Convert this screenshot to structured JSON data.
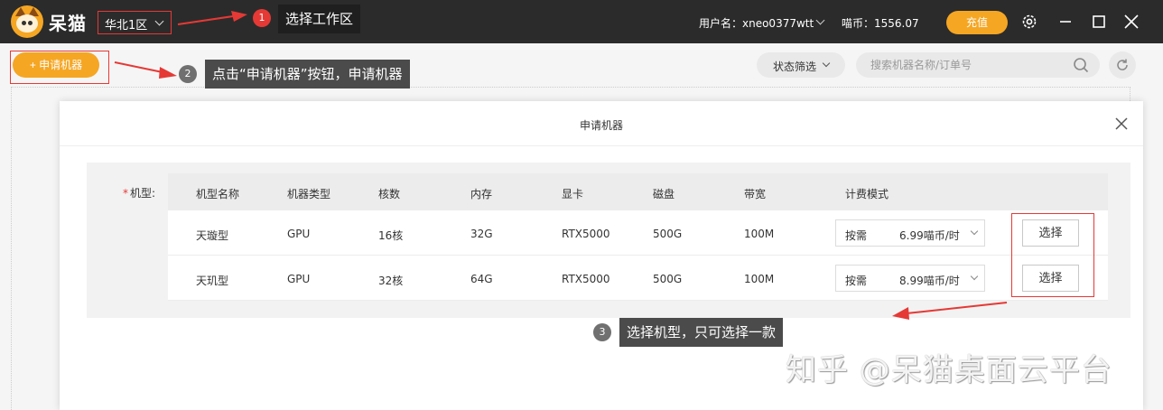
{
  "app": {
    "name": "呆猫"
  },
  "topbar": {
    "region": "华北1区",
    "user": "用户名：xneo0377wtt",
    "balance": "喵币：1556.07",
    "recharge_label": "充值"
  },
  "toolbar": {
    "apply_label": "+ 申请机器",
    "status_filter": "状态筛选",
    "search_placeholder": "搜索机器名称/订单号"
  },
  "annotations": [
    {
      "badge": "1",
      "text": "选择工作区"
    },
    {
      "badge": "2",
      "text": "点击“申请机器”按钮，申请机器"
    },
    {
      "badge": "3",
      "text": "选择机型，只可选择一款"
    }
  ],
  "dialog": {
    "title": "申请机器",
    "field_label": "机型:",
    "required_mark": "*",
    "columns": [
      "机型名称",
      "机器类型",
      "核数",
      "内存",
      "显卡",
      "磁盘",
      "带宽",
      "计费模式"
    ],
    "rows": [
      {
        "name": "天璇型",
        "type": "GPU",
        "cores": "16核",
        "memory": "32G",
        "gpu": "RTX5000",
        "disk": "500G",
        "bandwidth": "100M",
        "billing_mode": "按需",
        "price": "6.99喵币/时",
        "action": "选择"
      },
      {
        "name": "天玑型",
        "type": "GPU",
        "cores": "32核",
        "memory": "64G",
        "gpu": "RTX5000",
        "disk": "500G",
        "bandwidth": "100M",
        "billing_mode": "按需",
        "price": "8.99喵币/时",
        "action": "选择"
      }
    ]
  },
  "watermark": "知乎 @呆猫桌面云平台",
  "colors": {
    "accent": "#f5a623",
    "topbar": "#2b2b2b",
    "highlight": "#e53935"
  }
}
